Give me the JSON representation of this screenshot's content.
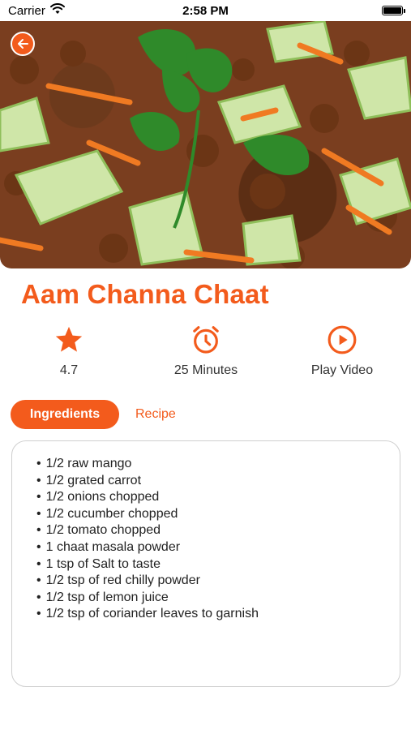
{
  "status_bar": {
    "carrier": "Carrier",
    "time": "2:58 PM"
  },
  "recipe": {
    "title": "Aam Channa Chaat"
  },
  "stats": {
    "rating": "4.7",
    "duration": "25 Minutes",
    "video": "Play Video"
  },
  "tabs": {
    "ingredients": "Ingredients",
    "recipe": "Recipe"
  },
  "ingredients": [
    "1/2 raw mango",
    "1/2 grated carrot",
    "1/2 onions chopped",
    "1/2 cucumber chopped",
    "1/2 tomato chopped",
    "1 chaat masala powder",
    "1 tsp of Salt to taste",
    "1/2 tsp of red chilly powder",
    "1/2 tsp of lemon juice",
    "1/2 tsp of coriander leaves to garnish"
  ],
  "colors": {
    "accent": "#f35b1c",
    "text": "#222222",
    "card_border": "#cfcfcf"
  },
  "icons": {
    "back": "arrow-left-icon",
    "rating": "star-icon",
    "duration": "alarm-clock-icon",
    "video": "play-circle-icon",
    "wifi": "wifi-icon",
    "battery": "battery-icon"
  }
}
